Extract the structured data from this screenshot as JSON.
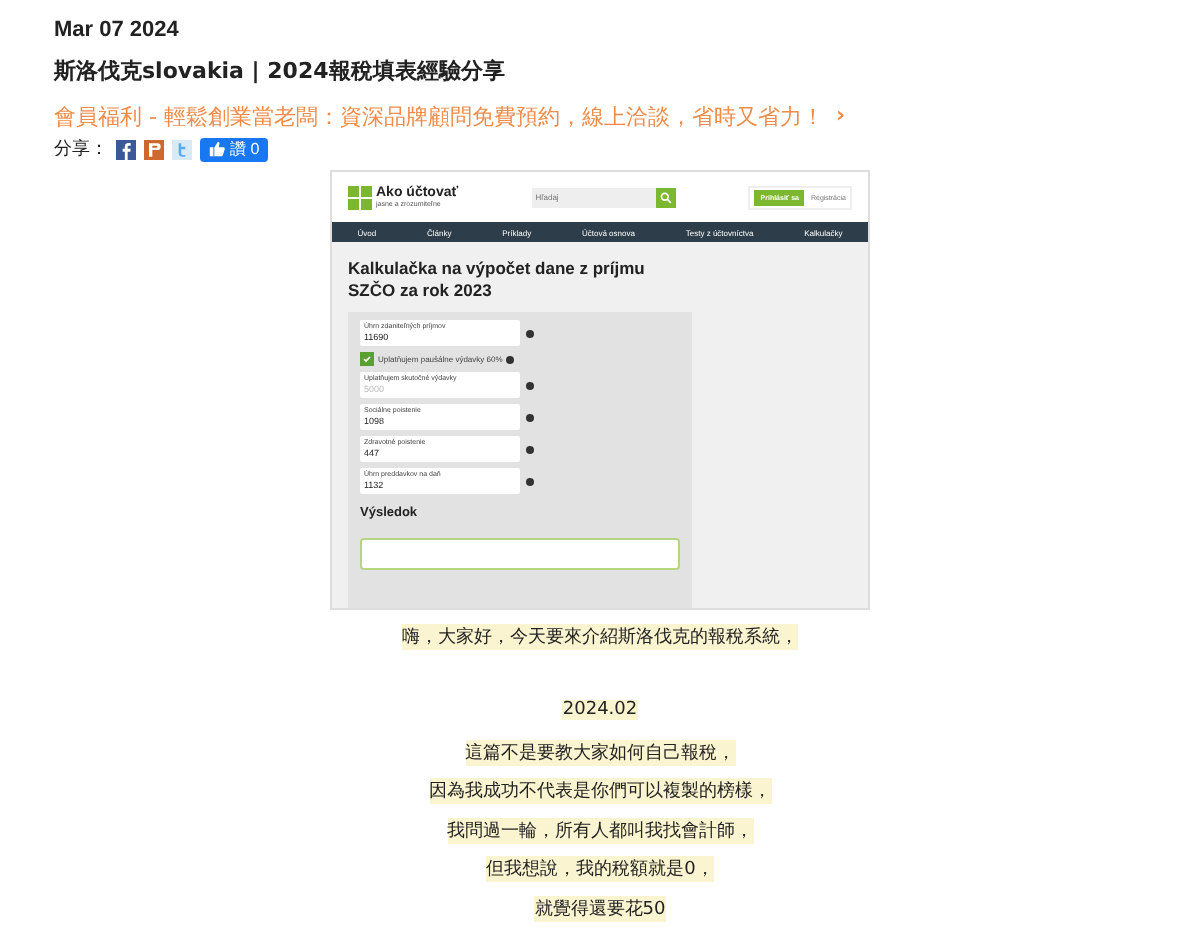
{
  "post": {
    "date": "Mar  07  2024",
    "title": "斯洛伐克slovakia | 2024報稅填表經驗分享",
    "promo": "會員福利 - 輕鬆創業當老闆：資深品牌顧問免費預約，線上洽談，省時又省力！",
    "promo_arrow": "›",
    "share_label": "分享：",
    "like": {
      "label": "讚",
      "count": "0"
    }
  },
  "screenshot": {
    "logo": "Ako účtovať",
    "tagline": "jasne a zrozumiteľne",
    "search": {
      "placeholder": "Hľadaj"
    },
    "login": "Prihlásiť sa",
    "register": "Registrácia",
    "nav": [
      "Úvod",
      "Články",
      "Príklady",
      "Účtová osnova",
      "Testy z účtovníctva",
      "Kalkulačky"
    ],
    "heading": "Kalkulačka na výpočet dane z príjmu SZČO za rok 2023",
    "fields": [
      {
        "kind": "input",
        "label": "Úhrn zdaniteľných príjmov",
        "value": "11690"
      },
      {
        "kind": "checkbox",
        "label": "Uplatňujem paušálne výdavky 60%",
        "checked": true
      },
      {
        "kind": "input",
        "label": "Uplatňujem skutočné výdavky",
        "placeholder": "5000"
      },
      {
        "kind": "input",
        "label": "Sociálne poistenie",
        "value": "1098"
      },
      {
        "kind": "input",
        "label": "Zdravotné poistenie",
        "value": "447"
      },
      {
        "kind": "input",
        "label": "Úhrn preddavkov na daň",
        "value": "1132"
      }
    ],
    "result_heading": "Výsledok"
  },
  "intro": "嗨，大家好，今天要來介紹斯洛伐克的報稅系統，",
  "paragraphs": [
    "2024.02",
    "這篇不是要教大家如何自己報稅，",
    "因為我成功不代表是你們可以複製的榜樣，",
    "我問過一輪，所有人都叫我找會計師，",
    "但我想說，我的稅額就是0，",
    "就覺得還要花50"
  ]
}
